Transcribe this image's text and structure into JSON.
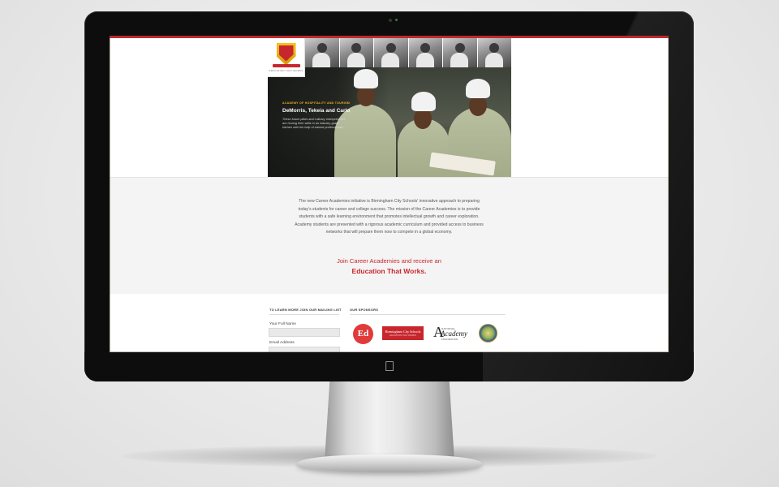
{
  "hero": {
    "kicker": "ACADEMY OF HOSPITALITY AND TOURISM",
    "title": "DeMorris, Tekeia and Carlo",
    "description": "These future pilots and culinary entrepreneurs are honing their skills in an industry-grade kitchen with the help of trained professionals.",
    "logo_tagline": "EDUCATION THAT WORKS"
  },
  "intro": {
    "paragraph": "The new Career Academies initiative is Birmingham City Schools' innovative approach to preparing today's students for career and college success. The mission of the Career Academies is to provide students with a safe learning environment that promotes intellectual growth and career exploration. Academy students are presented with a rigorous academic curriculum and provided access to business networks that will prepare them now to compete in a global economy.",
    "cta_line1": "Join Career Academies and receive an",
    "cta_line2": "Education That Works."
  },
  "mailing": {
    "heading": "TO LEARN MORE JOIN OUR MAILING LIST",
    "name_label": "Your Full Name",
    "email_label": "Email Address"
  },
  "sponsors": {
    "heading": "OUR SPONSORS",
    "ed_mark": "Ed",
    "bcs_name": "Birmingham City Schools",
    "bcs_sub": "EDUCATION THAT WORKS",
    "naf_small": "NATIONAL",
    "naf_big": "Academy",
    "naf_found": "FOUNDATION"
  },
  "colors": {
    "accent": "#c8262d",
    "hero_kicker": "#f4b41d",
    "bezel": "#0d0d0d",
    "intro_bg": "#f4f4f4"
  },
  "icons": {
    "apple": "apple-logo-icon",
    "logo": "shield-crest-icon"
  }
}
